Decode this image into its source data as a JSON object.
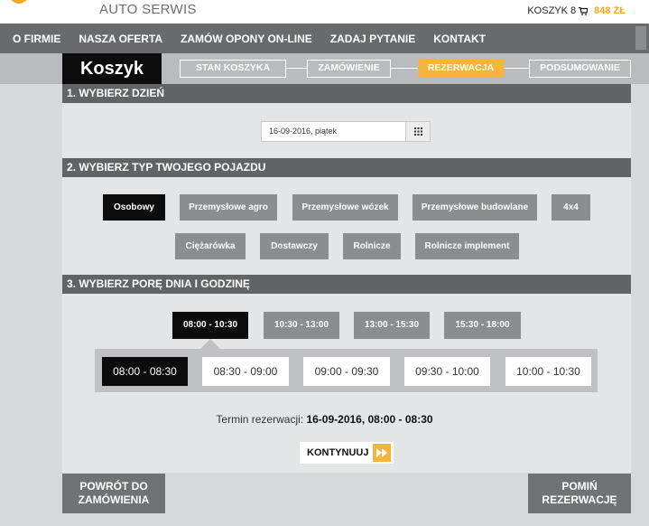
{
  "header": {
    "brand": "AUTO SERWIS",
    "cart_label": "KOSZYK 8",
    "cart_total": "848 ZŁ"
  },
  "nav": {
    "items": [
      "O FIRMIE",
      "NASZA OFERTA",
      "ZAMÓW OPONY ON-LINE",
      "ZADAJ PYTANIE",
      "KONTAKT"
    ]
  },
  "steps": {
    "title": "Koszyk",
    "items": [
      "STAN KOSZYKA",
      "ZAMÓWIENIE",
      "REZERWACJA",
      "PODSUMOWANIE"
    ],
    "active": "REZERWACJA"
  },
  "section1": {
    "title": "1. WYBIERZ DZIEŃ",
    "date_value": "16-09-2016, piątek"
  },
  "section2": {
    "title": "2. WYBIERZ TYP TWOJEGO POJAZDU",
    "vehicles": [
      "Osobowy",
      "Przemysłowe agro",
      "Przemysłowe wózek",
      "Przemysłowe budowlane",
      "4x4",
      "Ciężarówka",
      "Dostawczy",
      "Rolnicze",
      "Rolnicze implement"
    ],
    "selected": "Osobowy"
  },
  "section3": {
    "title": "3. WYBIERZ PORĘ DNIA I GODZINĘ",
    "time_ranges": [
      "08:00 - 10:30",
      "10:30 - 13:00",
      "13:00 - 15:30",
      "15:30 - 18:00"
    ],
    "selected_range": "08:00 - 10:30",
    "slots": [
      "08:00 - 08:30",
      "08:30 - 09:00",
      "09:00 - 09:30",
      "09:30 - 10:00",
      "10:00 - 10:30"
    ],
    "selected_slot": "08:00 - 08:30"
  },
  "summary": {
    "label": "Termin rezerwacji:",
    "value": "16-09-2016, 08:00 - 08:30"
  },
  "actions": {
    "continue": "KONTYNUUJ",
    "back_line1": "POWRÓT DO",
    "back_line2": "ZAMÓWIENIA",
    "skip_line1": "POMIŃ",
    "skip_line2": "REZERWACJĘ"
  },
  "colors": {
    "accent": "#f4b53a",
    "nav_bg": "#686a6d",
    "section_bg": "#626366",
    "button_bg": "#8b8d90",
    "selected_bg": "#0c0c0c"
  }
}
